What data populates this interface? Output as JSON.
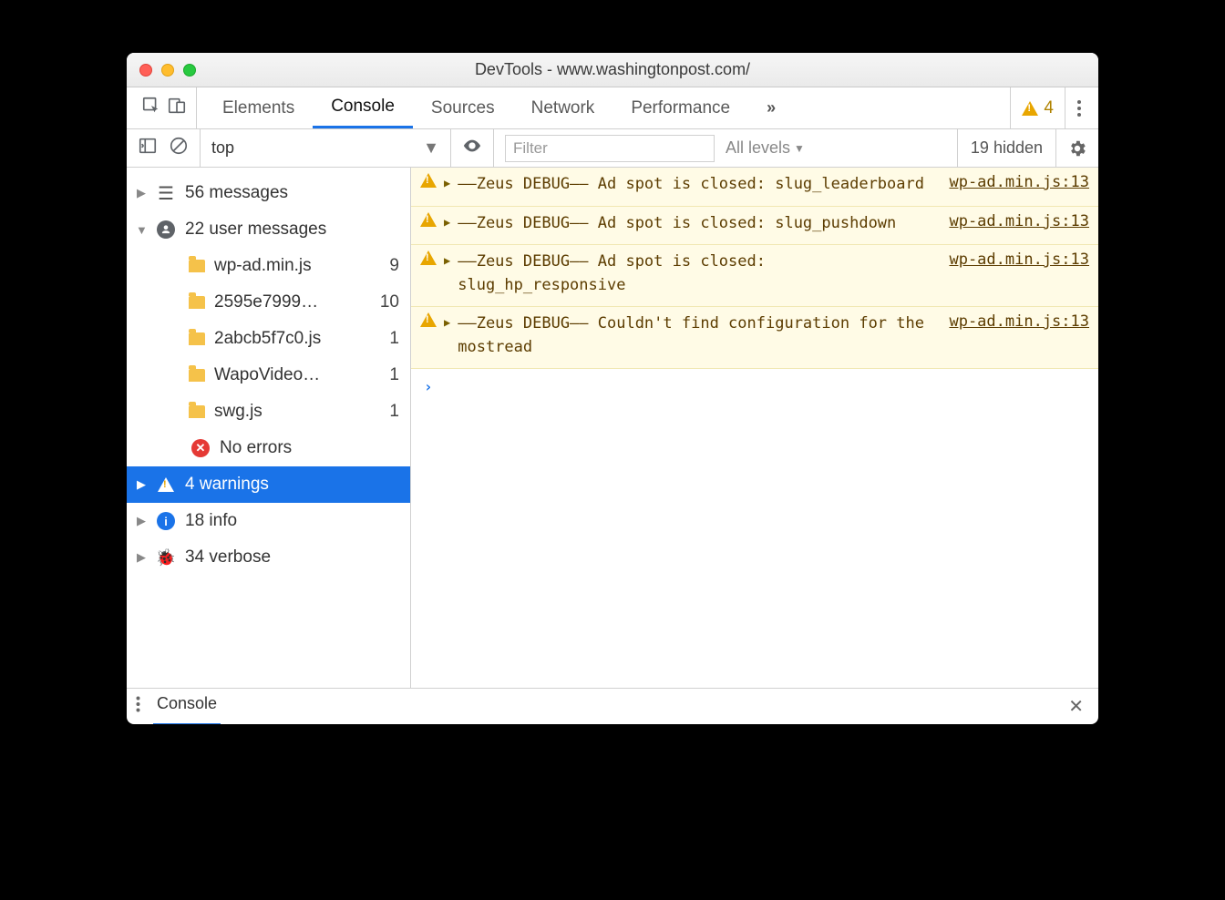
{
  "window": {
    "title": "DevTools - www.washingtonpost.com/"
  },
  "tabs": {
    "items": [
      "Elements",
      "Console",
      "Sources",
      "Network",
      "Performance"
    ],
    "active": 1,
    "warnBadge": "4"
  },
  "toolbar": {
    "context": "top",
    "filterPlaceholder": "Filter",
    "levels": "All levels",
    "hidden": "19 hidden"
  },
  "sidebar": {
    "messages": {
      "label": "56 messages"
    },
    "userMessages": {
      "label": "22 user messages"
    },
    "files": [
      {
        "name": "wp-ad.min.js",
        "count": "9"
      },
      {
        "name": "2595e7999…",
        "count": "10"
      },
      {
        "name": "2abcb5f7c0.js",
        "count": "1"
      },
      {
        "name": "WapoVideo…",
        "count": "1"
      },
      {
        "name": "swg.js",
        "count": "1"
      }
    ],
    "noErrors": "No errors",
    "warnings": "4 warnings",
    "info": "18 info",
    "verbose": "34 verbose"
  },
  "messages": [
    {
      "text": "––Zeus DEBUG–– Ad spot is closed: slug_leaderboard",
      "source": "wp-ad.min.js:13"
    },
    {
      "text": "––Zeus DEBUG–– Ad spot is closed: slug_pushdown",
      "source": "wp-ad.min.js:13"
    },
    {
      "text": "––Zeus DEBUG–– Ad spot is closed: slug_hp_responsive",
      "source": "wp-ad.min.js:13"
    },
    {
      "text": "––Zeus DEBUG–– Couldn't find configuration for the mostread",
      "source": "wp-ad.min.js:13"
    }
  ],
  "drawer": {
    "tab": "Console"
  }
}
